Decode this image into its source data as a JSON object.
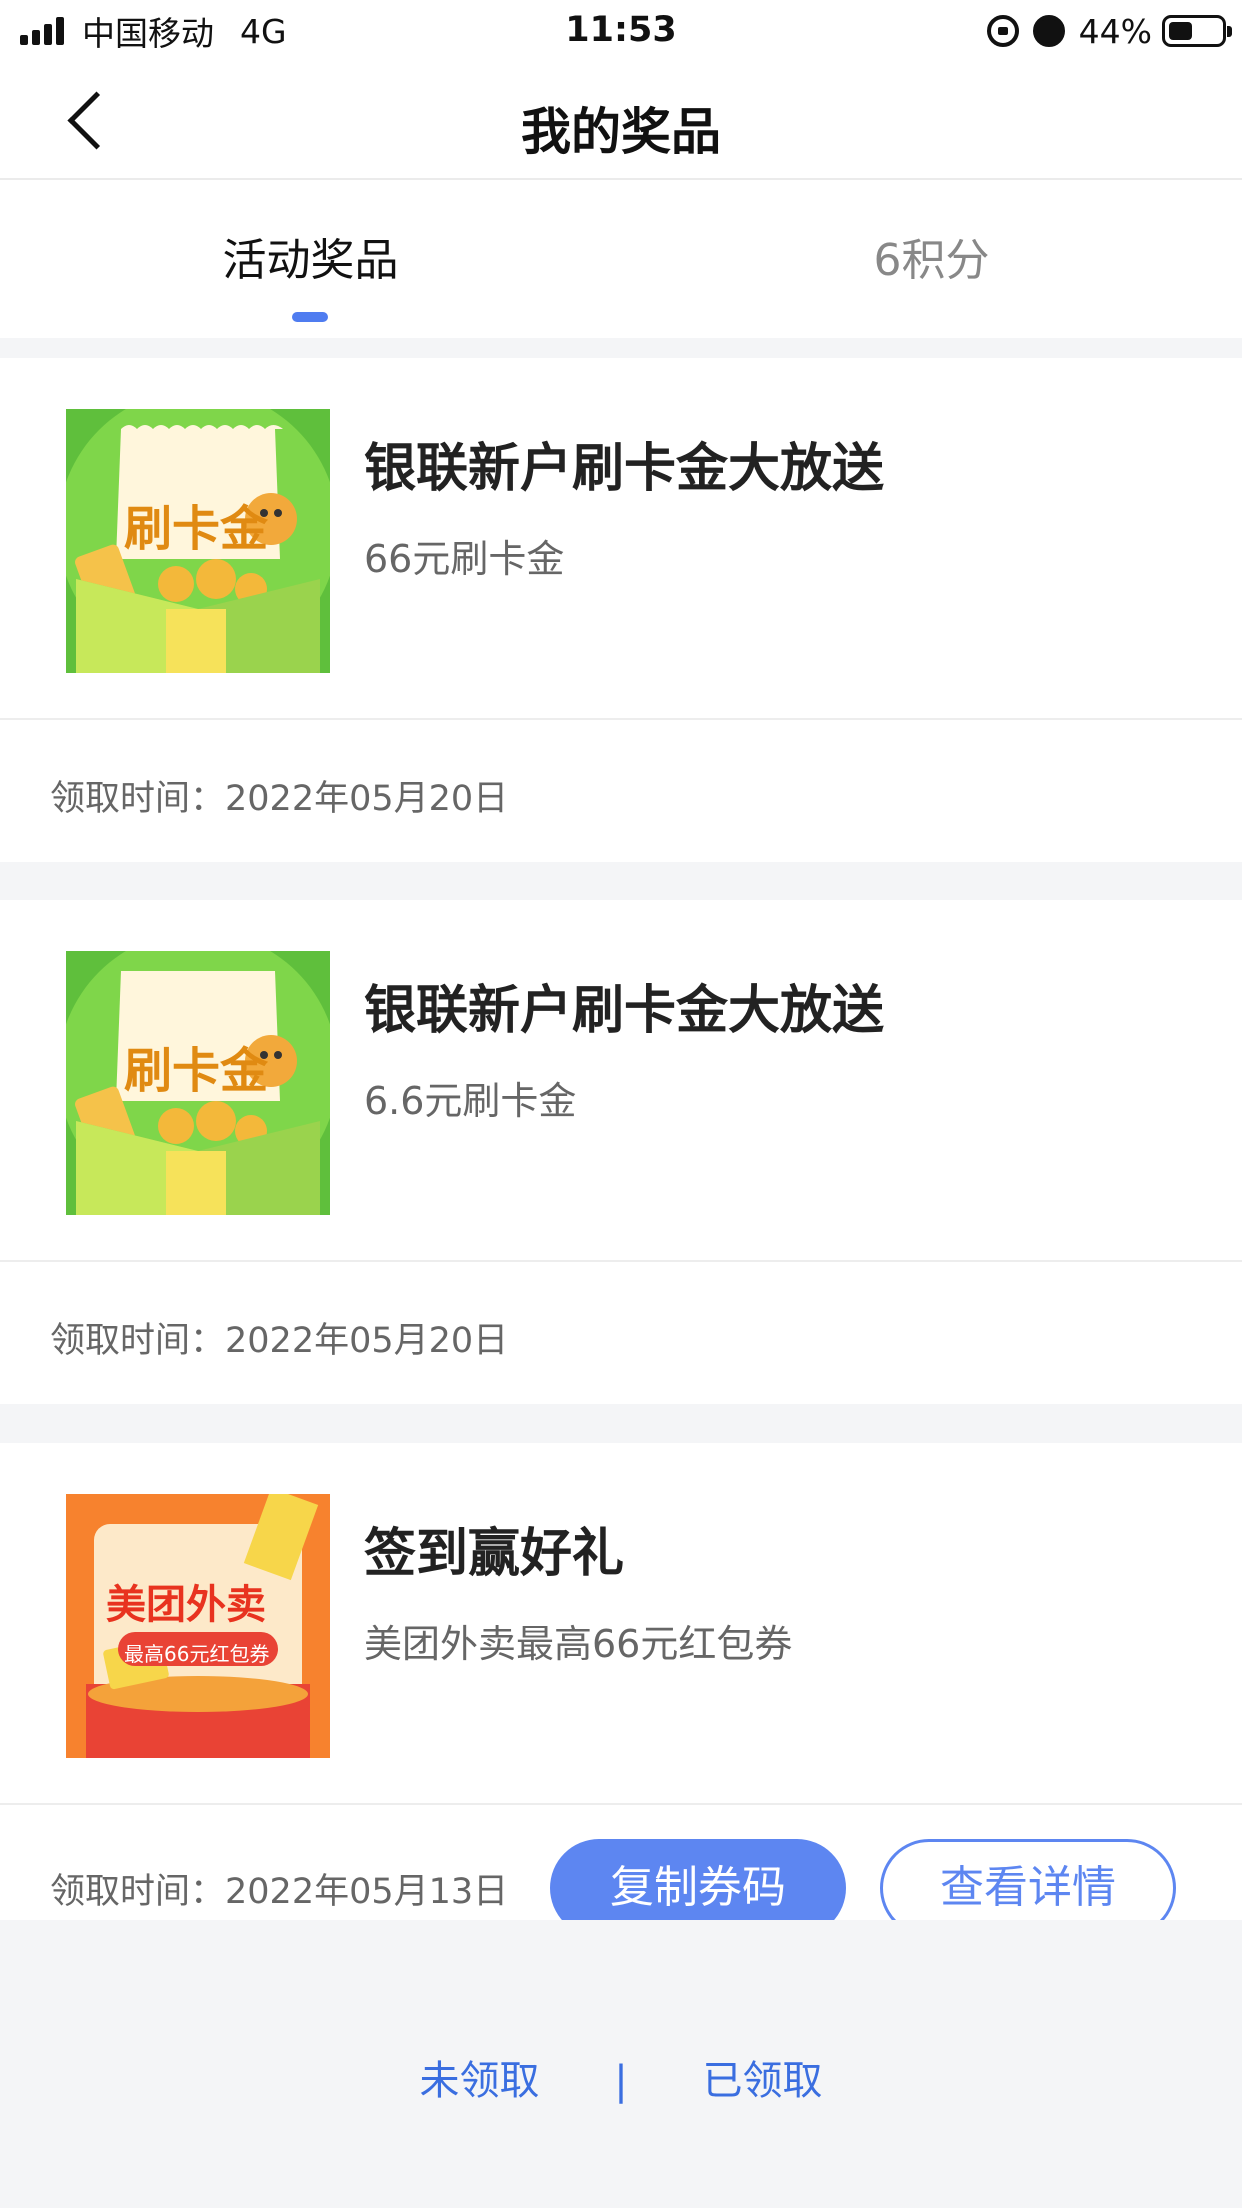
{
  "status_bar": {
    "carrier": "中国移动",
    "network": "4G",
    "time": "11:53",
    "battery": "44%",
    "battery_level": 0.44
  },
  "nav": {
    "title": "我的奖品",
    "back_icon": "chevron-left-icon"
  },
  "tabs": [
    {
      "label": "活动奖品",
      "active": true
    },
    {
      "label": "6积分",
      "active": false
    }
  ],
  "prizes": [
    {
      "title": "银联新户刷卡金大放送",
      "subtitle": "66元刷卡金",
      "thumb_text": "刷卡金",
      "claim_label": "领取时间：",
      "claim_date": "2022年05月20日"
    },
    {
      "title": "银联新户刷卡金大放送",
      "subtitle": "6.6元刷卡金",
      "thumb_text": "刷卡金",
      "claim_label": "领取时间：",
      "claim_date": "2022年05月20日"
    },
    {
      "title": "签到赢好礼",
      "subtitle": "美团外卖最高66元红包券",
      "thumb_text": "美团外卖",
      "thumb_subtext": "最高66元红包券",
      "claim_label": "领取时间：",
      "claim_date": "2022年05月13日",
      "buttons": {
        "copy": "复制券码",
        "detail": "查看详情"
      }
    }
  ],
  "bottom_tabs": {
    "unclaimed": "未领取",
    "separator": "|",
    "claimed": "已领取"
  },
  "colors": {
    "accent": "#5d86f1",
    "tab_indicator": "#4f7cf0",
    "background": "#f4f5f7"
  }
}
